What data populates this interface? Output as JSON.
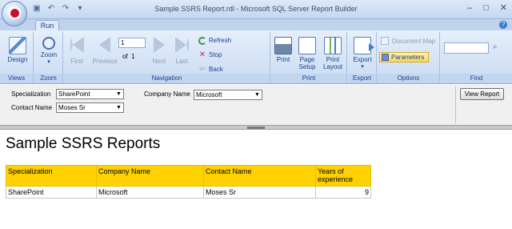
{
  "window": {
    "title": "Sample SSRS Report.rdl - Microsoft SQL Server Report Builder",
    "controls": [
      "–",
      "□",
      "✕"
    ]
  },
  "tabs": [
    {
      "label": "Run",
      "selected": true
    }
  ],
  "ribbon": {
    "groups": {
      "views": "Views",
      "zoom": "Zoom",
      "navigation": "Navigation",
      "print": "Print",
      "export": "Export",
      "options": "Options",
      "find": "Find"
    },
    "design_label": "Design",
    "zoom_label": "Zoom",
    "first_label": "First",
    "previous_label": "Previous",
    "next_label": "Next",
    "last_label": "Last",
    "current_page": "1",
    "of_label": "of",
    "total_pages": "1",
    "refresh_label": "Refresh",
    "stop_label": "Stop",
    "back_label": "Back",
    "print_label": "Print",
    "page_setup_label": "Page Setup",
    "print_layout_label": "Print Layout",
    "export_label": "Export",
    "document_map_label": "Document Map",
    "parameters_label": "Parameters",
    "find_value": ""
  },
  "parameters": {
    "specialization_label": "Specialization",
    "specialization_value": "SharePoint",
    "contact_name_label": "Contact Name",
    "contact_name_value": "Moses Sr",
    "company_name_label": "Company Name",
    "company_name_value": "Microsoft",
    "view_report_label": "View Report"
  },
  "report": {
    "title": "Sample SSRS Reports",
    "columns": [
      "Specialization",
      "Company Name",
      "Contact Name",
      "Years of experience"
    ],
    "rows": [
      [
        "SharePoint",
        "Microsoft",
        "Moses Sr",
        "9"
      ]
    ]
  }
}
